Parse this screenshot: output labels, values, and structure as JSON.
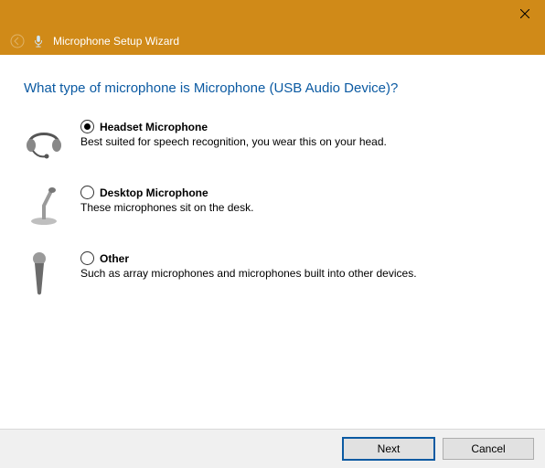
{
  "window": {
    "title": "Microphone Setup Wizard"
  },
  "heading": "What type of microphone is Microphone (USB Audio Device)?",
  "options": [
    {
      "label": "Headset Microphone",
      "description": "Best suited for speech recognition, you wear this on your head.",
      "selected": true
    },
    {
      "label": "Desktop Microphone",
      "description": "These microphones sit on the desk.",
      "selected": false
    },
    {
      "label": "Other",
      "description": "Such as array microphones and microphones built into other devices.",
      "selected": false
    }
  ],
  "buttons": {
    "next": "Next",
    "cancel": "Cancel"
  }
}
